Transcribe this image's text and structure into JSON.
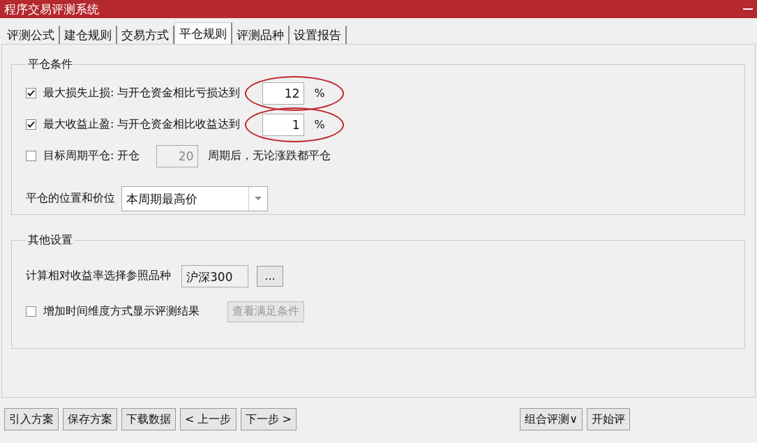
{
  "window": {
    "title": "程序交易评测系统"
  },
  "tabs": [
    {
      "label": "评测公式",
      "selected": false
    },
    {
      "label": "建仓规则",
      "selected": false
    },
    {
      "label": "交易方式",
      "selected": false
    },
    {
      "label": "平仓规则",
      "selected": true
    },
    {
      "label": "评测品种",
      "selected": false
    },
    {
      "label": "设置报告",
      "selected": false
    }
  ],
  "close_conditions": {
    "title": "平仓条件",
    "rows": [
      {
        "checked": true,
        "label": "最大损失止损: 与开仓资金相比亏损达到",
        "value": "12",
        "suffix": "%",
        "disabled": false,
        "highlighted": true
      },
      {
        "checked": true,
        "label": "最大收益止盈: 与开仓资金相比收益达到",
        "value": "1",
        "suffix": "%",
        "disabled": false,
        "highlighted": true
      },
      {
        "checked": false,
        "label": "目标周期平仓: 开仓",
        "value": "20",
        "suffix": "周期后，无论涨跌都平仓",
        "disabled": true,
        "highlighted": false
      }
    ],
    "position": {
      "label": "平仓的位置和价位",
      "value": "本周期最高价"
    }
  },
  "other_settings": {
    "title": "其他设置",
    "reference": {
      "label": "计算相对收益率选择参照品种",
      "value": "沪深300",
      "button": "..."
    },
    "time_dimension": {
      "checked": false,
      "label": "增加时间维度方式显示评测结果",
      "button": "查看满足条件",
      "button_disabled": true
    }
  },
  "buttons_left": [
    "引入方案",
    "保存方案",
    "下载数据",
    "< 上一步",
    "下一步 >"
  ],
  "buttons_right": [
    "组合评测∨",
    "开始评"
  ]
}
